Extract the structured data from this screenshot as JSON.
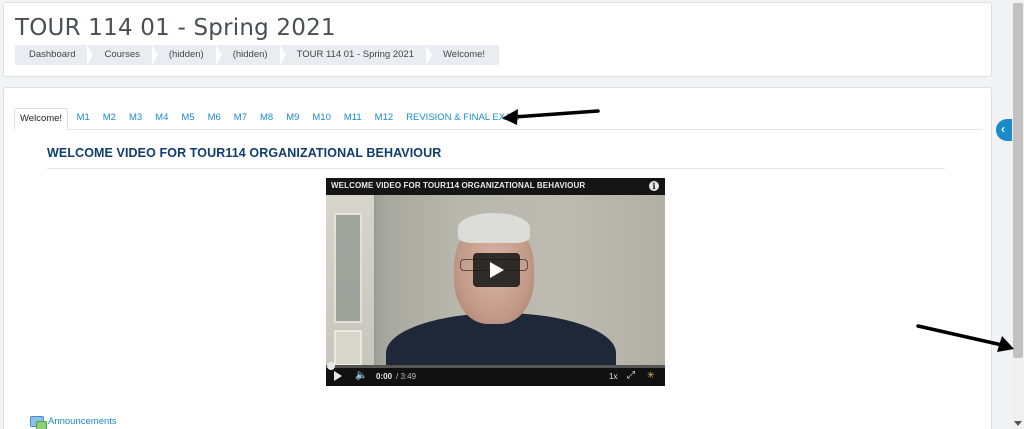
{
  "header": {
    "course_title": "TOUR 114 01 - Spring 2021",
    "breadcrumbs": [
      "Dashboard",
      "Courses",
      "(hidden)",
      "(hidden)",
      "TOUR 114 01 - Spring 2021",
      "Welcome!"
    ]
  },
  "tabs": [
    {
      "label": "Welcome!",
      "active": true
    },
    {
      "label": "M1"
    },
    {
      "label": "M2"
    },
    {
      "label": "M3"
    },
    {
      "label": "M4"
    },
    {
      "label": "M5"
    },
    {
      "label": "M6"
    },
    {
      "label": "M7"
    },
    {
      "label": "M8"
    },
    {
      "label": "M9"
    },
    {
      "label": "M10"
    },
    {
      "label": "M11"
    },
    {
      "label": "M12"
    },
    {
      "label": "REVISION & FINAL EXAM"
    }
  ],
  "section": {
    "title": "WELCOME VIDEO FOR TOUR114 ORGANIZATIONAL BEHAVIOUR"
  },
  "video": {
    "title": "WELCOME VIDEO FOR TOUR114 ORGANIZATIONAL BEHAVIOUR",
    "current_time": "0:00",
    "total_time": "/ 3:49",
    "speed": "1x",
    "progress": 0.0
  },
  "announcements": {
    "label": "Announcements"
  },
  "icons": {
    "info": "info-icon",
    "play": "play-icon",
    "volume": "volume-icon",
    "fullscreen": "fullscreen-icon",
    "drawer": "chevron-left-icon",
    "forum": "forum-icon"
  },
  "colors": {
    "link": "#1b8bc9",
    "title": "#0f3d6e",
    "accent": "#1b8bc9"
  }
}
